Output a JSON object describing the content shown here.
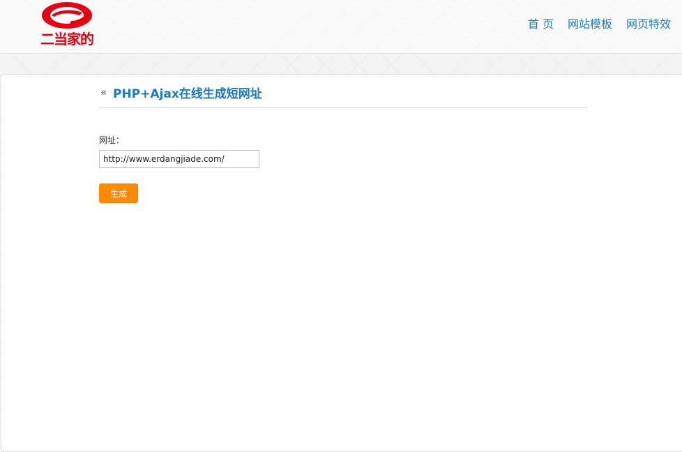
{
  "header": {
    "logo": {
      "icon": "e-swoosh-logo-icon",
      "text": "二当家的",
      "color": "#e60012"
    },
    "nav": [
      {
        "label": "首 页"
      },
      {
        "label": "网站模板"
      },
      {
        "label": "网页特效"
      }
    ],
    "nav_color": "#1a7bbf"
  },
  "main": {
    "back_icon": "«",
    "title": "PHP+Ajax在线生成短网址",
    "form": {
      "url_label": "网址：",
      "url_value": "http://www.erdangjiade.com/",
      "submit_label": "生成",
      "submit_color": "#ff8a00"
    }
  }
}
